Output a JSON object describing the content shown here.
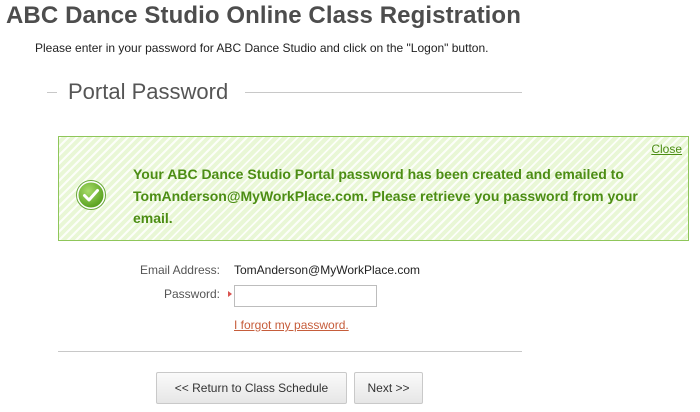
{
  "page": {
    "title": "ABC Dance Studio Online Class Registration",
    "instructions": "Please enter in your password for ABC Dance Studio and click on the \"Logon\" button."
  },
  "section": {
    "title": "Portal Password"
  },
  "notice": {
    "message": "Your ABC Dance Studio Portal password has been created and emailed to TomAnderson@MyWorkPlace.com. Please retrieve you password from your email.",
    "close_label": "Close",
    "icon": "checkmark-circle-icon",
    "colors": {
      "border": "#8fc65a",
      "background": "#e9f7d6",
      "text": "#4c8d14"
    }
  },
  "form": {
    "email_label": "Email Address:",
    "email_value": "TomAnderson@MyWorkPlace.com",
    "password_label": "Password:",
    "password_value": "",
    "forgot_label": "I forgot my password."
  },
  "buttons": {
    "back_label": "<< Return to Class Schedule",
    "next_label": "Next >>"
  }
}
